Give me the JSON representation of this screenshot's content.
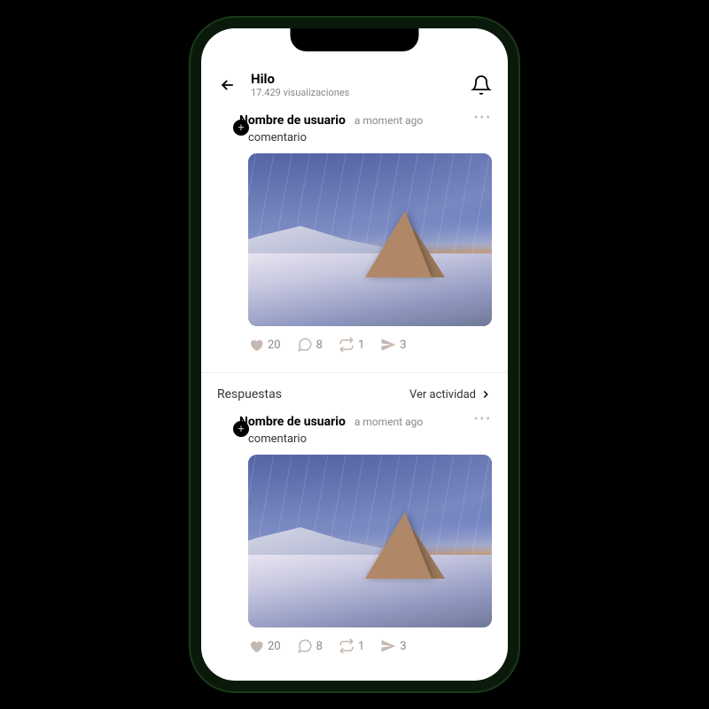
{
  "header": {
    "title": "Hilo",
    "subtitle": "17.429 visualizaciones"
  },
  "posts": [
    {
      "username": "Nombre de usuario",
      "time": "a moment ago",
      "comment": "comentario",
      "likes": "20",
      "comments": "8",
      "reposts": "1",
      "shares": "3"
    },
    {
      "username": "Nombre de usuario",
      "time": "a moment ago",
      "comment": "comentario",
      "likes": "20",
      "comments": "8",
      "reposts": "1",
      "shares": "3"
    }
  ],
  "replies": {
    "title": "Respuestas",
    "activity": "Ver actividad"
  }
}
